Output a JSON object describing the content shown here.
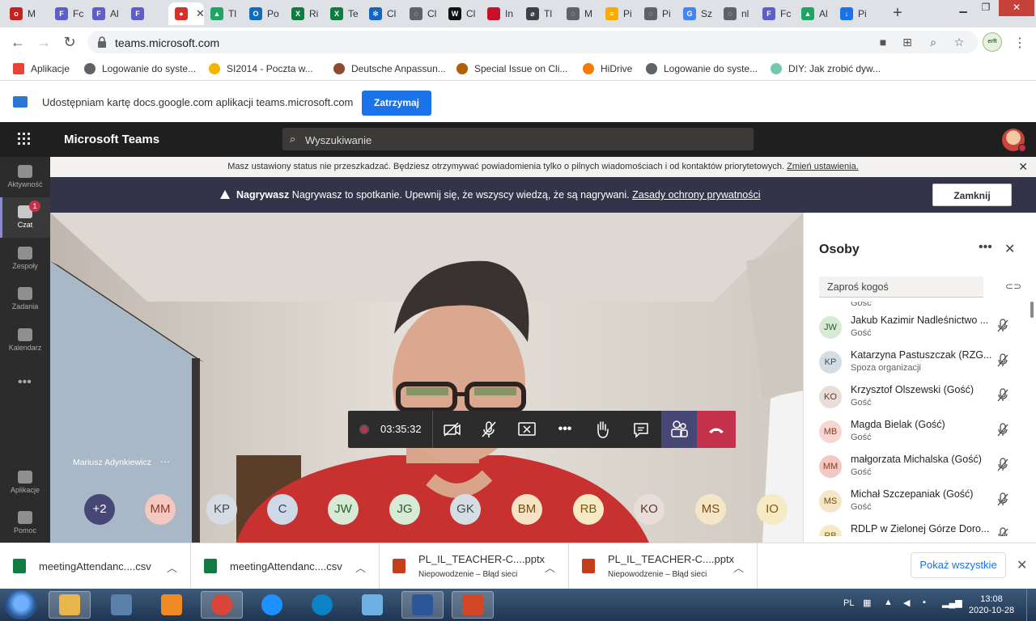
{
  "browser": {
    "tabs": [
      {
        "label": "M",
        "color": "#c5221f",
        "glyph": "o"
      },
      {
        "label": "Fc",
        "color": "#5b5fc7",
        "glyph": "F"
      },
      {
        "label": "Al",
        "color": "#5b5fc7",
        "glyph": "F"
      },
      {
        "label": "",
        "color": "#5b5fc7",
        "glyph": "F"
      },
      {
        "label": "",
        "color": "#d93025",
        "glyph": "●",
        "active": true
      },
      {
        "label": "Tl",
        "color": "#1fa463",
        "glyph": "▲"
      },
      {
        "label": "Po",
        "color": "#0f6cbd",
        "glyph": "O"
      },
      {
        "label": "Ri",
        "color": "#107c41",
        "glyph": "X"
      },
      {
        "label": "Te",
        "color": "#107c41",
        "glyph": "X"
      },
      {
        "label": "Cl",
        "color": "#1565c0",
        "glyph": "✻"
      },
      {
        "label": "Cl",
        "color": "#5f6368",
        "glyph": "◌"
      },
      {
        "label": "Cl",
        "color": "#111111",
        "glyph": "W"
      },
      {
        "label": "In",
        "color": "#c8102e",
        "glyph": ""
      },
      {
        "label": "Tl",
        "color": "#3c4043",
        "glyph": "⌀"
      },
      {
        "label": "M",
        "color": "#5f6368",
        "glyph": "◌"
      },
      {
        "label": "Pi",
        "color": "#f9ab00",
        "glyph": "≡"
      },
      {
        "label": "Pi",
        "color": "#5f6368",
        "glyph": "◌"
      },
      {
        "label": "Sz",
        "color": "#4285f4",
        "glyph": "G"
      },
      {
        "label": "nl",
        "color": "#5f6368",
        "glyph": "◌"
      },
      {
        "label": "Fc",
        "color": "#5b5fc7",
        "glyph": "F"
      },
      {
        "label": "Al",
        "color": "#1fa463",
        "glyph": "▲"
      },
      {
        "label": "Pi",
        "color": "#1a73e8",
        "glyph": "↓"
      }
    ],
    "url": "teams.microsoft.com",
    "profile_badge": "erft",
    "bookmarks": [
      "Aplikacje",
      "Logowanie do syste...",
      "SI2014 - Poczta w...",
      "Deutsche Anpassun...",
      "Special Issue on Cli...",
      "HiDrive",
      "Logowanie do syste...",
      "DIY: Jak zrobić dyw..."
    ],
    "bookmark_colors": [
      "#ea4335",
      "#5f6368",
      "#f4b400",
      "#8d4b2f",
      "#b06000",
      "#f57c00",
      "#5f6368",
      "#73c8b0"
    ]
  },
  "share_bar": {
    "message": "Udostępniam kartę docs.google.com aplikacji teams.microsoft.com",
    "stop_label": "Zatrzymaj"
  },
  "teams": {
    "title": "Microsoft Teams",
    "search_placeholder": "Wyszukiwanie",
    "rail": [
      {
        "label": "Aktywność"
      },
      {
        "label": "Czat",
        "badge": "1"
      },
      {
        "label": "Zespoły"
      },
      {
        "label": "Zadania"
      },
      {
        "label": "Kalendarz"
      },
      {
        "label": "Aplikacje"
      },
      {
        "label": "Pomoc"
      }
    ],
    "dnd_banner": {
      "text": "Masz ustawiony status nie przeszkadzać. Będziesz otrzymywać powiadomienia tylko o pilnych wiadomościach i od kontaktów priorytetowych. ",
      "link": "Zmień ustawienia."
    },
    "rec_banner": {
      "title": "Nagrywasz",
      "text": " Nagrywasz to spotkanie. Upewnij się, że wszyscy wiedzą, że są nagrywani. ",
      "link": "Zasady ochrony prywatności",
      "close_label": "Zamknij"
    },
    "call": {
      "presenter_name": "Mariusz Adynkiewicz",
      "timer": "03:35:32",
      "avatars": [
        {
          "initials": "+2",
          "bg": "#464775",
          "fg": "#ffffff"
        },
        {
          "initials": "MM",
          "bg": "#f2c8c0",
          "fg": "#8a3a2a"
        },
        {
          "initials": "KP",
          "bg": "#d5dde3",
          "fg": "#3d4a55"
        },
        {
          "initials": "C",
          "bg": "#cfd8e6",
          "fg": "#2e3e5c"
        },
        {
          "initials": "JW",
          "bg": "#d6ead6",
          "fg": "#2e5a2e"
        },
        {
          "initials": "JG",
          "bg": "#d6ead6",
          "fg": "#2e5a2e"
        },
        {
          "initials": "GK",
          "bg": "#d5dde3",
          "fg": "#3d4a55"
        },
        {
          "initials": "BM",
          "bg": "#f6e2c4",
          "fg": "#7a4a10"
        },
        {
          "initials": "RB",
          "bg": "#f6eac4",
          "fg": "#7a5a10"
        },
        {
          "initials": "KO",
          "bg": "#e8ddd8",
          "fg": "#5a3a2e"
        },
        {
          "initials": "MS",
          "bg": "#f6e6c8",
          "fg": "#7a4a10"
        },
        {
          "initials": "IO",
          "bg": "#f6eac4",
          "fg": "#7a5a10"
        }
      ]
    },
    "people_panel": {
      "title": "Osoby",
      "invite_placeholder": "Zaproś kogoś",
      "partial_role": "Gość",
      "people": [
        {
          "initials": "JW",
          "name": "Jakub Kazimir Nadleśnictwo ...",
          "role": "Gość",
          "bg": "#d6ead6",
          "fg": "#2e5a2e"
        },
        {
          "initials": "KP",
          "name": "Katarzyna Pastuszczak (RZG...",
          "role": "Spoza organizacji",
          "bg": "#d5dde3",
          "fg": "#3d4a55"
        },
        {
          "initials": "KO",
          "name": "Krzysztof Olszewski (Gość)",
          "role": "Gość",
          "bg": "#e8ddd8",
          "fg": "#5a3a2e"
        },
        {
          "initials": "MB",
          "name": "Magda Bielak (Gość)",
          "role": "Gość",
          "bg": "#f6d6d0",
          "fg": "#8a3a2a"
        },
        {
          "initials": "MM",
          "name": "małgorzata Michalska (Gość)",
          "role": "Gość",
          "bg": "#f2c8c0",
          "fg": "#8a3a2a"
        },
        {
          "initials": "MS",
          "name": "Michał Szczepaniak (Gość)",
          "role": "Gość",
          "bg": "#f6e6c8",
          "fg": "#7a4a10"
        },
        {
          "initials": "RB",
          "name": "RDLP w Zielonej Górze Doro...",
          "role": "",
          "bg": "#f6eac4",
          "fg": "#7a5a10"
        }
      ]
    }
  },
  "downloads": {
    "items": [
      {
        "name": "meetingAttendanc....csv",
        "status": "",
        "color": "#107c41"
      },
      {
        "name": "meetingAttendanc....csv",
        "status": "",
        "color": "#107c41"
      },
      {
        "name": "PL_IL_TEACHER-C....pptx",
        "status": "Niepowodzenie – Błąd sieci",
        "color": "#c43e1c"
      },
      {
        "name": "PL_IL_TEACHER-C....pptx",
        "status": "Niepowodzenie – Błąd sieci",
        "color": "#c43e1c"
      }
    ],
    "show_all_label": "Pokaż wszystkie"
  },
  "taskbar": {
    "apps": [
      {
        "name": "file-explorer",
        "color": "#e8b64c",
        "active": true
      },
      {
        "name": "media-center",
        "color": "#5a7fa8"
      },
      {
        "name": "media-player",
        "color": "#f08a24"
      },
      {
        "name": "chrome",
        "color": "#db4437",
        "active": true
      },
      {
        "name": "internet-explorer",
        "color": "#1e90ff"
      },
      {
        "name": "edge",
        "color": "#0a84c6"
      },
      {
        "name": "contacts",
        "color": "#6cb1e1"
      },
      {
        "name": "word",
        "color": "#2b579a",
        "active": true
      },
      {
        "name": "powerpoint",
        "color": "#d24726",
        "active": true
      }
    ],
    "lang": "PL",
    "time": "13:08",
    "date": "2020-10-28"
  }
}
